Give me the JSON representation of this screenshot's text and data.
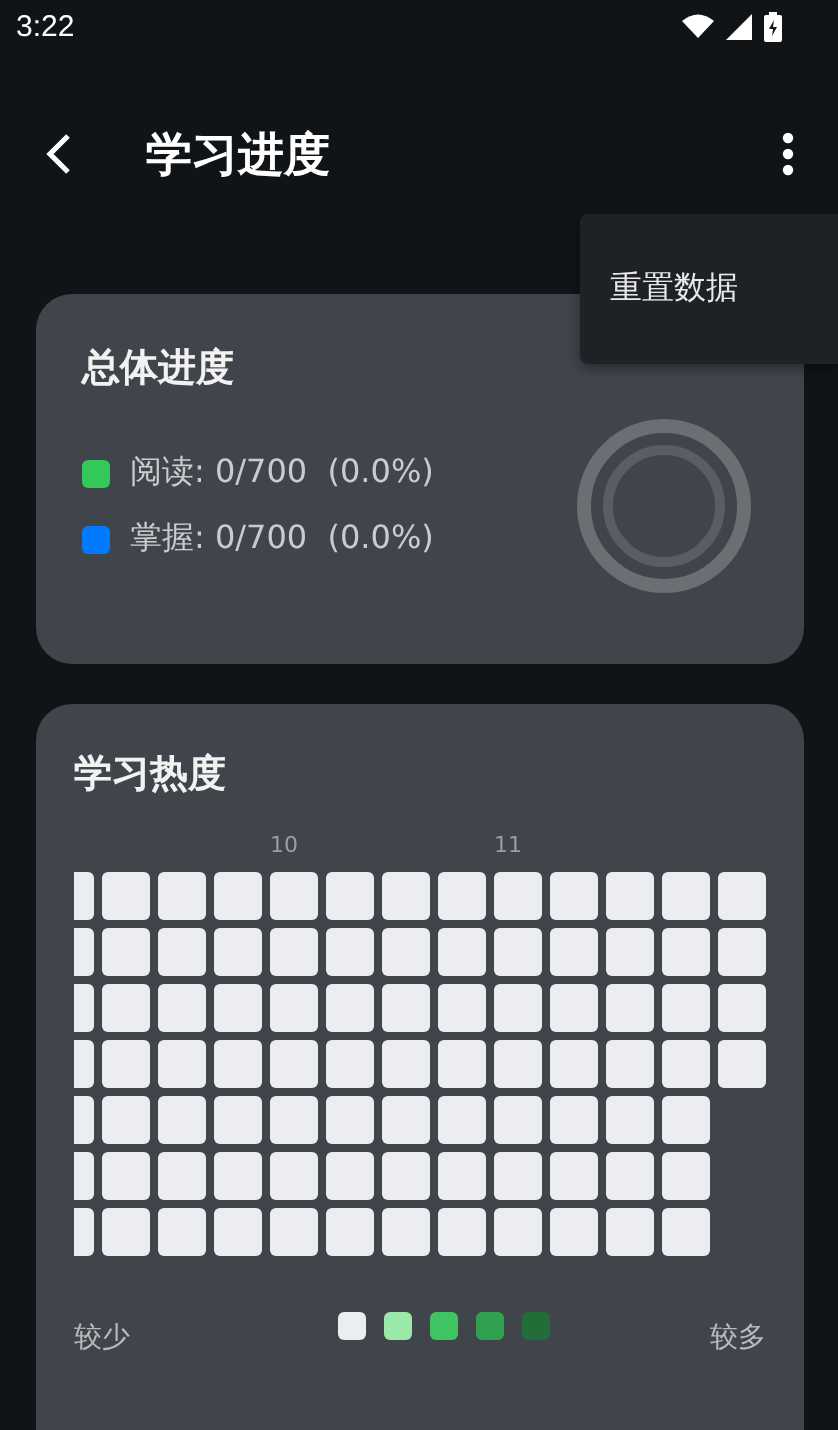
{
  "status_bar": {
    "time": "3:22"
  },
  "app_bar": {
    "title": "学习进度"
  },
  "menu": {
    "items": [
      {
        "label": "重置数据"
      }
    ]
  },
  "overall": {
    "title": "总体进度",
    "items": [
      {
        "label": "阅读: 0/700  (0.0%)",
        "color": "#34c759"
      },
      {
        "label": "掌握: 0/700  (0.0%)",
        "color": "#007aff"
      }
    ]
  },
  "heatmap": {
    "title": "学习热度",
    "weeks": [
      {
        "cells": [
          {
            "color": "#ebedf0"
          },
          {
            "color": "#ebedf0"
          },
          {
            "color": "#ebedf0"
          },
          {
            "color": "#ebedf0"
          },
          {
            "color": "#ebedf0"
          },
          {
            "color": "#ebedf0"
          },
          {
            "color": "#ebedf0"
          }
        ]
      },
      {
        "cells": [
          {
            "color": "#ebedf0"
          },
          {
            "color": "#ebedf0"
          },
          {
            "color": "#ebedf0"
          },
          {
            "color": "#ebedf0"
          },
          {
            "color": "#ebedf0"
          },
          {
            "color": "#ebedf0"
          },
          {
            "color": "#ebedf0"
          }
        ]
      },
      {
        "cells": [
          {
            "color": "#ebedf0"
          },
          {
            "color": "#ebedf0"
          },
          {
            "color": "#ebedf0"
          },
          {
            "color": "#ebedf0"
          },
          {
            "color": "#ebedf0"
          },
          {
            "color": "#ebedf0"
          },
          {
            "color": "#ebedf0"
          }
        ]
      },
      {
        "cells": [
          {
            "color": "#ebedf0"
          },
          {
            "color": "#ebedf0"
          },
          {
            "color": "#ebedf0"
          },
          {
            "color": "#ebedf0"
          },
          {
            "color": "#ebedf0"
          },
          {
            "color": "#ebedf0"
          },
          {
            "color": "#ebedf0"
          }
        ]
      },
      {
        "month": "10",
        "cells": [
          {
            "color": "#ebedf0"
          },
          {
            "color": "#ebedf0"
          },
          {
            "color": "#ebedf0"
          },
          {
            "color": "#ebedf0"
          },
          {
            "color": "#ebedf0"
          },
          {
            "color": "#ebedf0"
          },
          {
            "color": "#ebedf0"
          }
        ]
      },
      {
        "cells": [
          {
            "color": "#ebedf0"
          },
          {
            "color": "#ebedf0"
          },
          {
            "color": "#ebedf0"
          },
          {
            "color": "#ebedf0"
          },
          {
            "color": "#ebedf0"
          },
          {
            "color": "#ebedf0"
          },
          {
            "color": "#ebedf0"
          }
        ]
      },
      {
        "cells": [
          {
            "color": "#ebedf0"
          },
          {
            "color": "#ebedf0"
          },
          {
            "color": "#ebedf0"
          },
          {
            "color": "#ebedf0"
          },
          {
            "color": "#ebedf0"
          },
          {
            "color": "#ebedf0"
          },
          {
            "color": "#ebedf0"
          }
        ]
      },
      {
        "cells": [
          {
            "color": "#ebedf0"
          },
          {
            "color": "#ebedf0"
          },
          {
            "color": "#ebedf0"
          },
          {
            "color": "#ebedf0"
          },
          {
            "color": "#ebedf0"
          },
          {
            "color": "#ebedf0"
          },
          {
            "color": "#ebedf0"
          }
        ]
      },
      {
        "month": "11",
        "cells": [
          {
            "color": "#ebedf0"
          },
          {
            "color": "#ebedf0"
          },
          {
            "color": "#ebedf0"
          },
          {
            "color": "#ebedf0"
          },
          {
            "color": "#ebedf0"
          },
          {
            "color": "#ebedf0"
          },
          {
            "color": "#ebedf0"
          }
        ]
      },
      {
        "cells": [
          {
            "color": "#ebedf0"
          },
          {
            "color": "#ebedf0"
          },
          {
            "color": "#ebedf0"
          },
          {
            "color": "#ebedf0"
          },
          {
            "color": "#ebedf0"
          },
          {
            "color": "#ebedf0"
          },
          {
            "color": "#ebedf0"
          }
        ]
      },
      {
        "cells": [
          {
            "color": "#ebedf0"
          },
          {
            "color": "#ebedf0"
          },
          {
            "color": "#ebedf0"
          },
          {
            "color": "#ebedf0"
          },
          {
            "color": "#ebedf0"
          },
          {
            "color": "#ebedf0"
          },
          {
            "color": "#ebedf0"
          }
        ]
      },
      {
        "cells": [
          {
            "color": "#ebedf0"
          },
          {
            "color": "#ebedf0"
          },
          {
            "color": "#ebedf0"
          },
          {
            "color": "#ebedf0"
          },
          {
            "color": "#ebedf0"
          },
          {
            "color": "#ebedf0"
          },
          {
            "color": "#ebedf0"
          }
        ]
      },
      {
        "cells": [
          {
            "color": "#ebedf0"
          },
          {
            "color": "#ebedf0"
          },
          {
            "color": "#ebedf0"
          },
          {
            "color": "#ebedf0"
          }
        ]
      }
    ],
    "legend": {
      "less": "较少",
      "more": "较多",
      "colors": [
        {
          "color": "#ebedf0"
        },
        {
          "color": "#9be9a8"
        },
        {
          "color": "#40c463"
        },
        {
          "color": "#30a14e"
        },
        {
          "color": "#216e39"
        }
      ]
    }
  }
}
